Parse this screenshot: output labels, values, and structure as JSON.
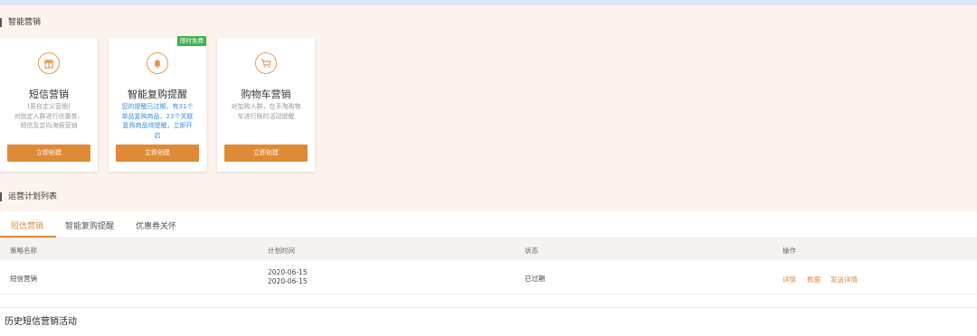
{
  "section1": {
    "title": "智能营销"
  },
  "cards": [
    {
      "title": "短信营销",
      "desc_line1": "(原自定义营销)",
      "desc_line2": "对指定人群进行优惠券、",
      "desc_line3": "短信及定向海报营销",
      "button": "立即创建"
    },
    {
      "title": "智能复购提醒",
      "badge": "限时免费",
      "desc_line1": "您的提醒已过期，有31个",
      "desc_line2": "单品复购商品，23个关联",
      "desc_line3": "复购商品待提醒，立即开",
      "desc_line4": "启",
      "button": "立即创建"
    },
    {
      "title": "购物车营销",
      "desc_line1": "对加购人群，在手淘购物",
      "desc_line2": "车进行限时活动提醒",
      "button": "立即创建"
    }
  ],
  "section2": {
    "title": "运营计划列表"
  },
  "tabs": [
    "短信营销",
    "智能复购提醒",
    "优惠券关怀"
  ],
  "table": {
    "headers": [
      "策略名称",
      "计划时间",
      "状态",
      "操作"
    ],
    "rows": [
      {
        "name": "短信营销",
        "start": "2020-06-15",
        "end": "2020-06-15",
        "status": "已过期",
        "actions": [
          "详情",
          "数据",
          "发送详情"
        ]
      }
    ]
  },
  "history": {
    "title": "历史短信营销活动"
  },
  "colors": {
    "accent": "#e08a35",
    "badge": "#3cb44a",
    "link_blue": "#3a8ee6",
    "background": "#fdf3ee"
  }
}
